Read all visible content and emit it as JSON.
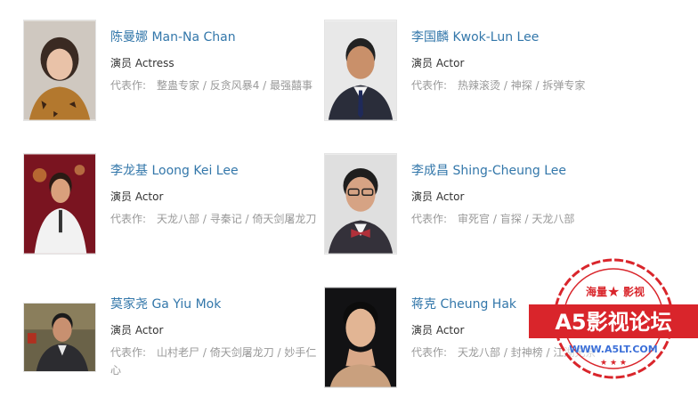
{
  "works_label": "代表作:",
  "people": [
    {
      "name": "陈曼娜 Man-Na Chan",
      "role": "演员 Actress",
      "works": "整蛊专家 / 反贪风暴4 / 最强囍事"
    },
    {
      "name": "李国麟 Kwok-Lun Lee",
      "role": "演员 Actor",
      "works": "热辣滚烫 / 神探 / 拆弹专家"
    },
    {
      "name": "李龙基 Loong Kei Lee",
      "role": "演员 Actor",
      "works": "天龙八部 / 寻秦记 / 倚天剑屠龙刀"
    },
    {
      "name": "李成昌 Shing-Cheung Lee",
      "role": "演员 Actor",
      "works": "审死官 / 盲探 / 天龙八部"
    },
    {
      "name": "莫家尧 Ga Yiu Mok",
      "role": "演员 Actor",
      "works": "山村老尸 / 倚天剑屠龙刀 / 妙手仁心"
    },
    {
      "name": "蒋克 Cheung Hak",
      "role": "演员 Actor",
      "works": "天龙八部 / 封神榜 / 江湖无奈"
    }
  ],
  "watermark": {
    "top_left": "海量",
    "top_right": "影视",
    "title": "A5影视论坛",
    "url": "WWW.A5LT.COM"
  },
  "colors": {
    "name_link": "#3377aa",
    "stamp_red": "#d9252b",
    "stamp_text": "#ffffff"
  }
}
